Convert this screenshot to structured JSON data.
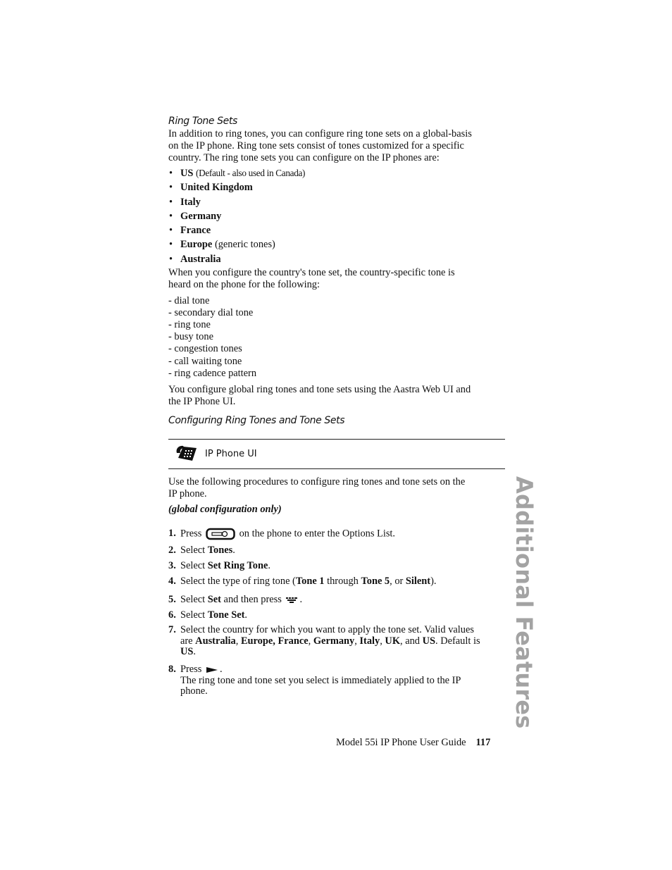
{
  "section": {
    "heading": "Ring Tone Sets",
    "intro": "In addition to ring tones, you can configure ring tone sets on a global-basis on the IP phone. Ring tone sets consist of tones customized for a specific country. The ring tone sets you can configure on the IP phones are:",
    "intro_lines": [
      "In addition to ring tones, you can configure ring tone sets on a global-basis",
      "on the IP phone. Ring tone sets consist of tones customized for a specific",
      "country. The ring tone sets you can configure on the IP phones are:"
    ],
    "countries": [
      {
        "name": "US",
        "note": "(Default - also used in Canada)"
      },
      {
        "name": "United Kingdom",
        "note": ""
      },
      {
        "name": "Italy",
        "note": ""
      },
      {
        "name": "Germany",
        "note": ""
      },
      {
        "name": "France",
        "note": ""
      },
      {
        "name": "Europe",
        "note": "(generic tones)"
      },
      {
        "name": "Australia",
        "note": ""
      }
    ],
    "tone_intro_lines": [
      "When you configure the country's tone set, the country-specific tone is",
      "heard on the phone for the following:"
    ],
    "tones": [
      "- dial tone",
      "- secondary dial tone",
      "- ring tone",
      "- busy tone",
      "- congestion tones",
      "- call waiting tone",
      "- ring cadence pattern"
    ],
    "config_note_lines": [
      "You configure global ring tones and tone sets using the Aastra Web UI and",
      "the IP Phone UI."
    ]
  },
  "subsection": {
    "heading": "Configuring Ring Tones and Tone Sets",
    "box_label": "IP Phone UI",
    "box_icon": "desk-phone-icon",
    "intro_lines": [
      "Use the following procedures to configure ring tones and tone sets on the",
      "IP phone."
    ],
    "scope": "(global configuration only)"
  },
  "steps": [
    {
      "num": "1.",
      "parts": [
        "Press ",
        "[options-key-icon]",
        " on the phone to enter the Options List."
      ]
    },
    {
      "num": "2.",
      "pre": "Select ",
      "bold": "Tones",
      "post": "."
    },
    {
      "num": "3.",
      "pre": "Select ",
      "bold": "Set Ring Tone",
      "post": "."
    },
    {
      "num": "4.",
      "pre": "Select the type of ring tone (",
      "b1": "Tone 1",
      "mid": " through ",
      "b2": "Tone 5",
      "mid2": ", or ",
      "b3": "Silent",
      "post": ")."
    },
    {
      "num": "5.",
      "pre": "Select ",
      "bold": "Set",
      "post": " and then press ",
      "end": "."
    },
    {
      "num": "6.",
      "pre": "Select ",
      "bold": "Tone Set",
      "post": "."
    },
    {
      "num": "7.",
      "line1": "Select the country for which you want to apply the tone set. Valid values",
      "are": "are ",
      "values": [
        "Australia",
        "Europe",
        "France",
        "Germany",
        "Italy",
        "UK"
      ],
      "and": "and",
      "last": "US",
      "default_pre": ". Default is",
      "default_val": "US",
      "default_post": "."
    },
    {
      "num": "8.",
      "pre": "Press ",
      "end": ".",
      "result_lines": [
        "The ring tone and tone set you select is immediately applied to the IP",
        "phone."
      ]
    }
  ],
  "side_tab": "Additional Features",
  "footer": {
    "guide": "Model 55i IP Phone User Guide",
    "page_number": "117"
  }
}
